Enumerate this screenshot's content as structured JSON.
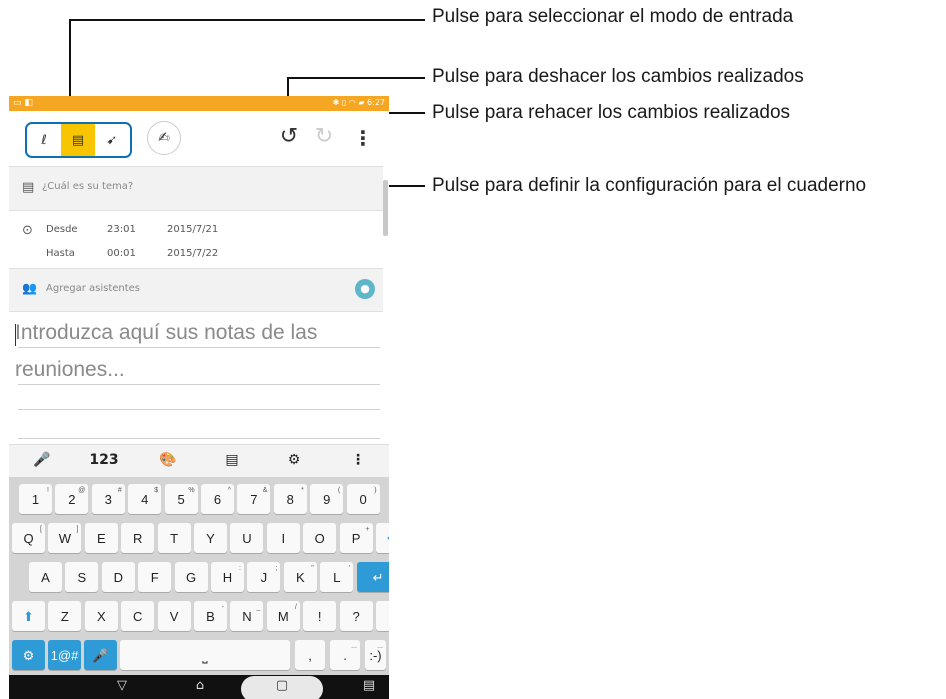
{
  "callouts": {
    "mode": "Pulse para seleccionar el modo de entrada",
    "undo": "Pulse para deshacer los cambios realizados",
    "redo": "Pulse para rehacer los cambios realizados",
    "settings": "Pulse para definir la configuración para el cuaderno"
  },
  "status_bar": {
    "time": "6:27"
  },
  "meeting": {
    "topic_placeholder": "¿Cuál es su tema?",
    "from_label": "Desde",
    "from_time": "23:01",
    "from_date": "2015/7/21",
    "to_label": "Hasta",
    "to_time": "00:01",
    "to_date": "2015/7/22",
    "attendees_placeholder": "Agregar asistentes",
    "notes_line1": "Introduzca aquí sus notas de las",
    "notes_line2": "reuniones..."
  },
  "keyboard_toolbar": {
    "numbers_label": "123"
  },
  "keyboard": {
    "row1": [
      [
        "1",
        "!"
      ],
      [
        "2",
        "@"
      ],
      [
        "3",
        "#"
      ],
      [
        "4",
        "$"
      ],
      [
        "5",
        "%"
      ],
      [
        "6",
        "^"
      ],
      [
        "7",
        "&"
      ],
      [
        "8",
        "*"
      ],
      [
        "9",
        "("
      ],
      [
        "0",
        ")"
      ]
    ],
    "row2": [
      [
        "Q",
        "["
      ],
      [
        "W",
        "]"
      ],
      [
        "E",
        ""
      ],
      [
        "R",
        ""
      ],
      [
        "T",
        ""
      ],
      [
        "Y",
        ""
      ],
      [
        "U",
        ""
      ],
      [
        "I",
        ""
      ],
      [
        "O",
        ""
      ],
      [
        "P",
        "+"
      ]
    ],
    "row3": [
      [
        "A",
        ""
      ],
      [
        "S",
        ""
      ],
      [
        "D",
        ""
      ],
      [
        "F",
        ""
      ],
      [
        "G",
        ""
      ],
      [
        "H",
        ":"
      ],
      [
        "J",
        ";"
      ],
      [
        "K",
        "\""
      ],
      [
        "L",
        "'"
      ]
    ],
    "row4": [
      [
        "Z",
        ""
      ],
      [
        "X",
        ""
      ],
      [
        "C",
        ""
      ],
      [
        "V",
        ""
      ],
      [
        "B",
        "-"
      ],
      [
        "N",
        "_"
      ],
      [
        "M",
        "/"
      ],
      [
        "!",
        ""
      ],
      [
        "?",
        ""
      ]
    ],
    "symbols_label": "1@#",
    "comma": ",",
    "period": ".",
    "smiley": ":-)",
    "period_alt": "...",
    "smiley_alt": "..."
  },
  "colors": {
    "status_bar": "#f5a623",
    "mode_highlight": "#f7c600",
    "mode_border": "#0f6fb5",
    "key_accent": "#2e9ad6"
  }
}
